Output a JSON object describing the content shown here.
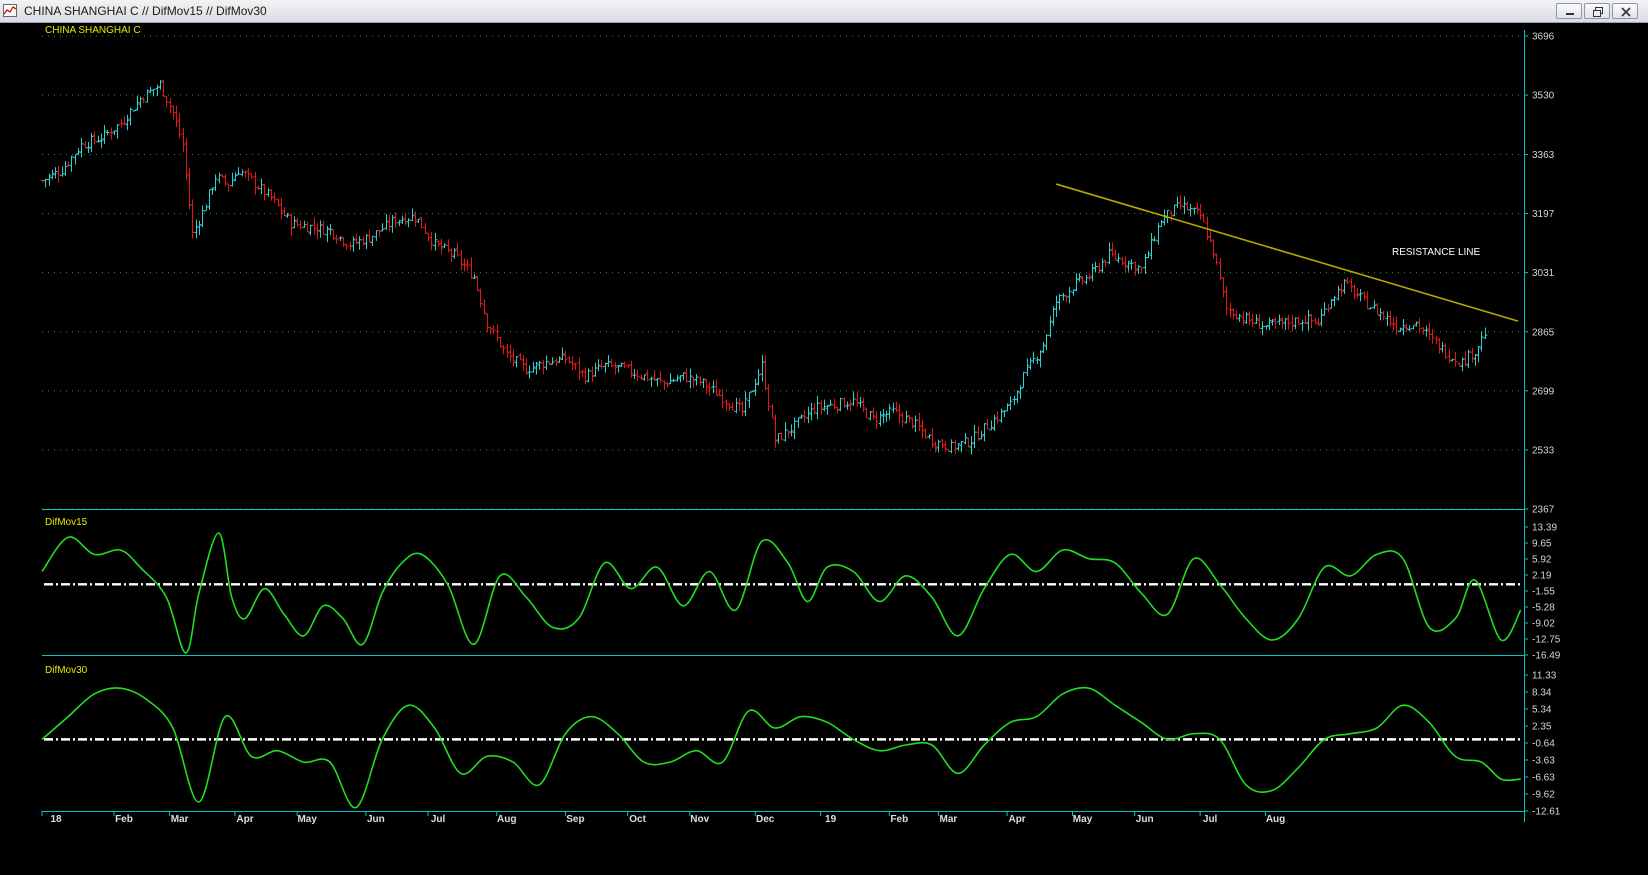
{
  "window": {
    "title": "CHINA SHANGHAI C // DifMov15 // DifMov30"
  },
  "icons": {
    "app": "chart-icon",
    "minimize": "minimize-icon",
    "restore": "restore-icon",
    "close": "close-icon"
  },
  "colors": {
    "background": "#000000",
    "axis": "#00c8c8",
    "grid": "#17a017",
    "up_bar": "#30d0d0",
    "down_bar": "#e01818",
    "oscillator": "#22dd22",
    "zero_line": "#ffffff",
    "trendline": "#b8a800",
    "panel_title": "#e8e800"
  },
  "chart_data": [
    {
      "type": "ohlc",
      "title": "CHINA SHANGHAI C",
      "ylim": [
        2367,
        3696
      ],
      "yticks": [
        3696,
        3530,
        3363,
        3197,
        3031,
        2865,
        2699,
        2533,
        2367
      ],
      "grid": true,
      "x_unit": "month",
      "x_range": [
        0,
        20
      ],
      "trendline": {
        "from": [
          15.5,
          3280
        ],
        "to": [
          19.92,
          2895
        ],
        "label": "RESISTANCE LINE"
      },
      "series_keypoints": [
        [
          0.0,
          3290
        ],
        [
          0.3,
          3320
        ],
        [
          0.6,
          3390
        ],
        [
          0.9,
          3410
        ],
        [
          1.2,
          3450
        ],
        [
          1.5,
          3520
        ],
        [
          1.8,
          3560
        ],
        [
          2.0,
          3480
        ],
        [
          2.15,
          3390
        ],
        [
          2.3,
          3140
        ],
        [
          2.45,
          3200
        ],
        [
          2.65,
          3300
        ],
        [
          2.85,
          3280
        ],
        [
          3.0,
          3320
        ],
        [
          3.2,
          3290
        ],
        [
          3.5,
          3240
        ],
        [
          3.8,
          3170
        ],
        [
          4.1,
          3160
        ],
        [
          4.4,
          3150
        ],
        [
          4.7,
          3110
        ],
        [
          5.0,
          3130
        ],
        [
          5.4,
          3180
        ],
        [
          5.7,
          3190
        ],
        [
          6.0,
          3110
        ],
        [
          6.3,
          3080
        ],
        [
          6.6,
          3020
        ],
        [
          6.8,
          2890
        ],
        [
          7.1,
          2800
        ],
        [
          7.4,
          2760
        ],
        [
          7.7,
          2780
        ],
        [
          8.0,
          2790
        ],
        [
          8.3,
          2740
        ],
        [
          8.6,
          2770
        ],
        [
          8.9,
          2760
        ],
        [
          9.2,
          2740
        ],
        [
          9.5,
          2720
        ],
        [
          9.8,
          2740
        ],
        [
          10.1,
          2720
        ],
        [
          10.4,
          2680
        ],
        [
          10.7,
          2640
        ],
        [
          11.0,
          2770
        ],
        [
          11.2,
          2560
        ],
        [
          11.5,
          2600
        ],
        [
          11.8,
          2650
        ],
        [
          12.1,
          2660
        ],
        [
          12.4,
          2670
        ],
        [
          12.7,
          2620
        ],
        [
          13.0,
          2640
        ],
        [
          13.3,
          2610
        ],
        [
          13.6,
          2560
        ],
        [
          13.9,
          2540
        ],
        [
          14.2,
          2560
        ],
        [
          14.5,
          2610
        ],
        [
          14.8,
          2660
        ],
        [
          15.0,
          2740
        ],
        [
          15.3,
          2830
        ],
        [
          15.5,
          2950
        ],
        [
          15.8,
          3000
        ],
        [
          16.0,
          3020
        ],
        [
          16.3,
          3080
        ],
        [
          16.6,
          3060
        ],
        [
          16.8,
          3040
        ],
        [
          17.1,
          3180
        ],
        [
          17.4,
          3220
        ],
        [
          17.7,
          3190
        ],
        [
          17.9,
          3090
        ],
        [
          18.1,
          2930
        ],
        [
          18.4,
          2900
        ],
        [
          18.7,
          2880
        ],
        [
          19.0,
          2890
        ],
        [
          19.3,
          2900
        ],
        [
          19.5,
          2890
        ],
        [
          19.7,
          2960
        ],
        [
          19.9,
          3000
        ],
        [
          20.2,
          2950
        ],
        [
          20.5,
          2910
        ],
        [
          20.7,
          2880
        ],
        [
          21.0,
          2890
        ],
        [
          21.2,
          2850
        ],
        [
          21.5,
          2800
        ],
        [
          21.7,
          2780
        ],
        [
          21.9,
          2810
        ],
        [
          22.1,
          2880
        ]
      ]
    },
    {
      "type": "line",
      "title": "DifMov15",
      "ylim": [
        -16.49,
        13.39
      ],
      "yticks": [
        13.39,
        9.65,
        5.92,
        2.19,
        -1.55,
        -5.28,
        -9.02,
        -12.75,
        -16.49
      ],
      "zero_line": 0,
      "points": [
        [
          0.0,
          3
        ],
        [
          0.4,
          11
        ],
        [
          0.8,
          7
        ],
        [
          1.2,
          8
        ],
        [
          1.5,
          4
        ],
        [
          1.9,
          -3
        ],
        [
          2.2,
          -16
        ],
        [
          2.4,
          -2
        ],
        [
          2.7,
          12
        ],
        [
          2.9,
          -3
        ],
        [
          3.1,
          -8
        ],
        [
          3.4,
          -1
        ],
        [
          3.7,
          -7
        ],
        [
          4.0,
          -12
        ],
        [
          4.3,
          -5
        ],
        [
          4.6,
          -8
        ],
        [
          4.9,
          -14
        ],
        [
          5.2,
          -2
        ],
        [
          5.5,
          5
        ],
        [
          5.8,
          7
        ],
        [
          6.2,
          0
        ],
        [
          6.6,
          -14
        ],
        [
          7.0,
          2
        ],
        [
          7.4,
          -3
        ],
        [
          7.8,
          -10
        ],
        [
          8.2,
          -8
        ],
        [
          8.6,
          5
        ],
        [
          9.0,
          -1
        ],
        [
          9.4,
          4
        ],
        [
          9.8,
          -5
        ],
        [
          10.2,
          3
        ],
        [
          10.6,
          -6
        ],
        [
          11.0,
          10
        ],
        [
          11.4,
          5
        ],
        [
          11.7,
          -4
        ],
        [
          12.0,
          4
        ],
        [
          12.4,
          3
        ],
        [
          12.8,
          -4
        ],
        [
          13.2,
          2
        ],
        [
          13.6,
          -3
        ],
        [
          14.0,
          -12
        ],
        [
          14.4,
          -1
        ],
        [
          14.8,
          7
        ],
        [
          15.2,
          3
        ],
        [
          15.6,
          8
        ],
        [
          16.0,
          6
        ],
        [
          16.4,
          5
        ],
        [
          16.8,
          -2
        ],
        [
          17.2,
          -7
        ],
        [
          17.6,
          6
        ],
        [
          18.0,
          0
        ],
        [
          18.4,
          -8
        ],
        [
          18.8,
          -13
        ],
        [
          19.2,
          -8
        ],
        [
          19.6,
          4
        ],
        [
          20.0,
          2
        ],
        [
          20.4,
          7
        ],
        [
          20.8,
          6
        ],
        [
          21.2,
          -10
        ],
        [
          21.6,
          -8
        ],
        [
          21.9,
          1
        ],
        [
          22.3,
          -13
        ],
        [
          22.6,
          -6
        ]
      ]
    },
    {
      "type": "line",
      "title": "DifMov30",
      "ylim": [
        -12.61,
        11.33
      ],
      "yticks": [
        11.33,
        8.34,
        5.34,
        2.35,
        -0.64,
        -3.63,
        -6.63,
        -9.62,
        -12.61
      ],
      "zero_line": 0,
      "points": [
        [
          0.0,
          0
        ],
        [
          0.4,
          4
        ],
        [
          0.8,
          8
        ],
        [
          1.2,
          9
        ],
        [
          1.6,
          7
        ],
        [
          2.0,
          2
        ],
        [
          2.4,
          -11
        ],
        [
          2.8,
          4
        ],
        [
          3.2,
          -3
        ],
        [
          3.6,
          -2
        ],
        [
          4.0,
          -4
        ],
        [
          4.4,
          -4
        ],
        [
          4.8,
          -12
        ],
        [
          5.2,
          0
        ],
        [
          5.6,
          6
        ],
        [
          6.0,
          2
        ],
        [
          6.4,
          -6
        ],
        [
          6.8,
          -3
        ],
        [
          7.2,
          -4
        ],
        [
          7.6,
          -8
        ],
        [
          8.0,
          1
        ],
        [
          8.4,
          4
        ],
        [
          8.8,
          1
        ],
        [
          9.2,
          -4
        ],
        [
          9.6,
          -4
        ],
        [
          10.0,
          -2
        ],
        [
          10.4,
          -4
        ],
        [
          10.8,
          5
        ],
        [
          11.2,
          2
        ],
        [
          11.6,
          4
        ],
        [
          12.0,
          3
        ],
        [
          12.4,
          0
        ],
        [
          12.8,
          -2
        ],
        [
          13.2,
          -1
        ],
        [
          13.6,
          -1
        ],
        [
          14.0,
          -6
        ],
        [
          14.4,
          -1
        ],
        [
          14.8,
          3
        ],
        [
          15.2,
          4
        ],
        [
          15.6,
          8
        ],
        [
          16.0,
          9
        ],
        [
          16.4,
          6
        ],
        [
          16.8,
          3
        ],
        [
          17.2,
          0
        ],
        [
          17.6,
          1
        ],
        [
          18.0,
          0
        ],
        [
          18.4,
          -8
        ],
        [
          18.8,
          -9
        ],
        [
          19.2,
          -5
        ],
        [
          19.6,
          0
        ],
        [
          20.0,
          1
        ],
        [
          20.4,
          2
        ],
        [
          20.8,
          6
        ],
        [
          21.2,
          3
        ],
        [
          21.6,
          -3
        ],
        [
          22.0,
          -4
        ],
        [
          22.3,
          -7
        ],
        [
          22.6,
          -7
        ]
      ]
    }
  ],
  "x_axis": {
    "labels": [
      {
        "t": 0.0,
        "text": "18"
      },
      {
        "t": 1.1,
        "text": "Feb"
      },
      {
        "t": 1.95,
        "text": "Mar"
      },
      {
        "t": 2.95,
        "text": "Apr"
      },
      {
        "t": 3.9,
        "text": "May"
      },
      {
        "t": 4.95,
        "text": "Jun"
      },
      {
        "t": 5.9,
        "text": "Jul"
      },
      {
        "t": 6.95,
        "text": "Aug"
      },
      {
        "t": 8.0,
        "text": "Sep"
      },
      {
        "t": 8.95,
        "text": "Oct"
      },
      {
        "t": 9.9,
        "text": "Nov"
      },
      {
        "t": 10.9,
        "text": "Dec"
      },
      {
        "t": 11.9,
        "text": "19"
      },
      {
        "t": 12.95,
        "text": "Feb"
      },
      {
        "t": 13.7,
        "text": "Mar"
      },
      {
        "t": 14.75,
        "text": "Apr"
      },
      {
        "t": 15.75,
        "text": "May"
      },
      {
        "t": 16.7,
        "text": "Jun"
      },
      {
        "t": 17.7,
        "text": "Jul"
      },
      {
        "t": 18.7,
        "text": "Aug"
      }
    ]
  }
}
